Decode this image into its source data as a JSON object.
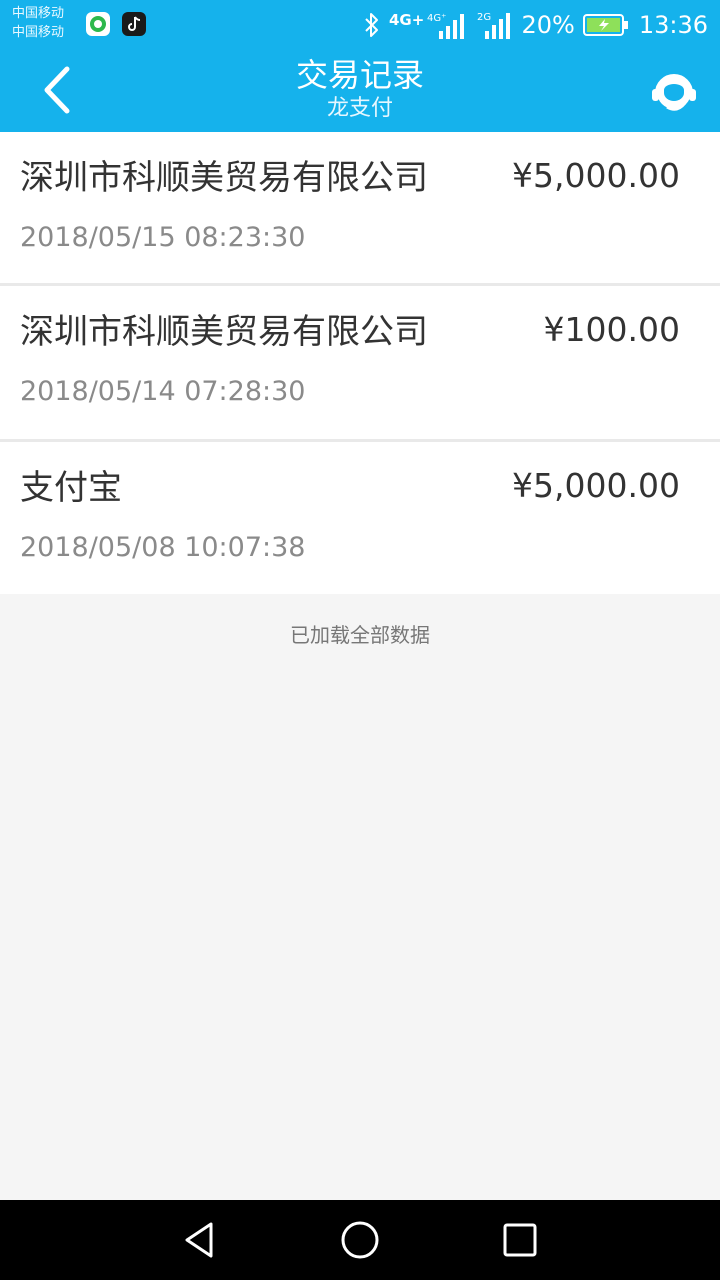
{
  "status_bar": {
    "carrier_1": "中国移动",
    "carrier_2": "中国移动",
    "network_1": "4G+",
    "network_1b": "4G⁺",
    "network_2": "2G",
    "battery": "20%",
    "time": "13:36",
    "icons": [
      "bluetooth-icon",
      "signal-icon",
      "battery-icon"
    ]
  },
  "header": {
    "title": "交易记录",
    "subtitle": "龙支付",
    "back_icon": "chevron-left-icon",
    "service_icon": "customer-service-icon",
    "bg_color": "#15b2ec"
  },
  "transactions": [
    {
      "merchant": "深圳市科顺美贸易有限公司",
      "amount": "¥5,000.00",
      "datetime": "2018/05/15  08:23:30"
    },
    {
      "merchant": "深圳市科顺美贸易有限公司",
      "amount": "¥100.00",
      "datetime": "2018/05/14  07:28:30"
    },
    {
      "merchant": "支付宝",
      "amount": "¥5,000.00",
      "datetime": "2018/05/08  10:07:38"
    }
  ],
  "footer_note": "已加载全部数据",
  "nav_bar": {
    "icons": [
      "nav-back-icon",
      "nav-home-icon",
      "nav-recent-icon"
    ]
  }
}
